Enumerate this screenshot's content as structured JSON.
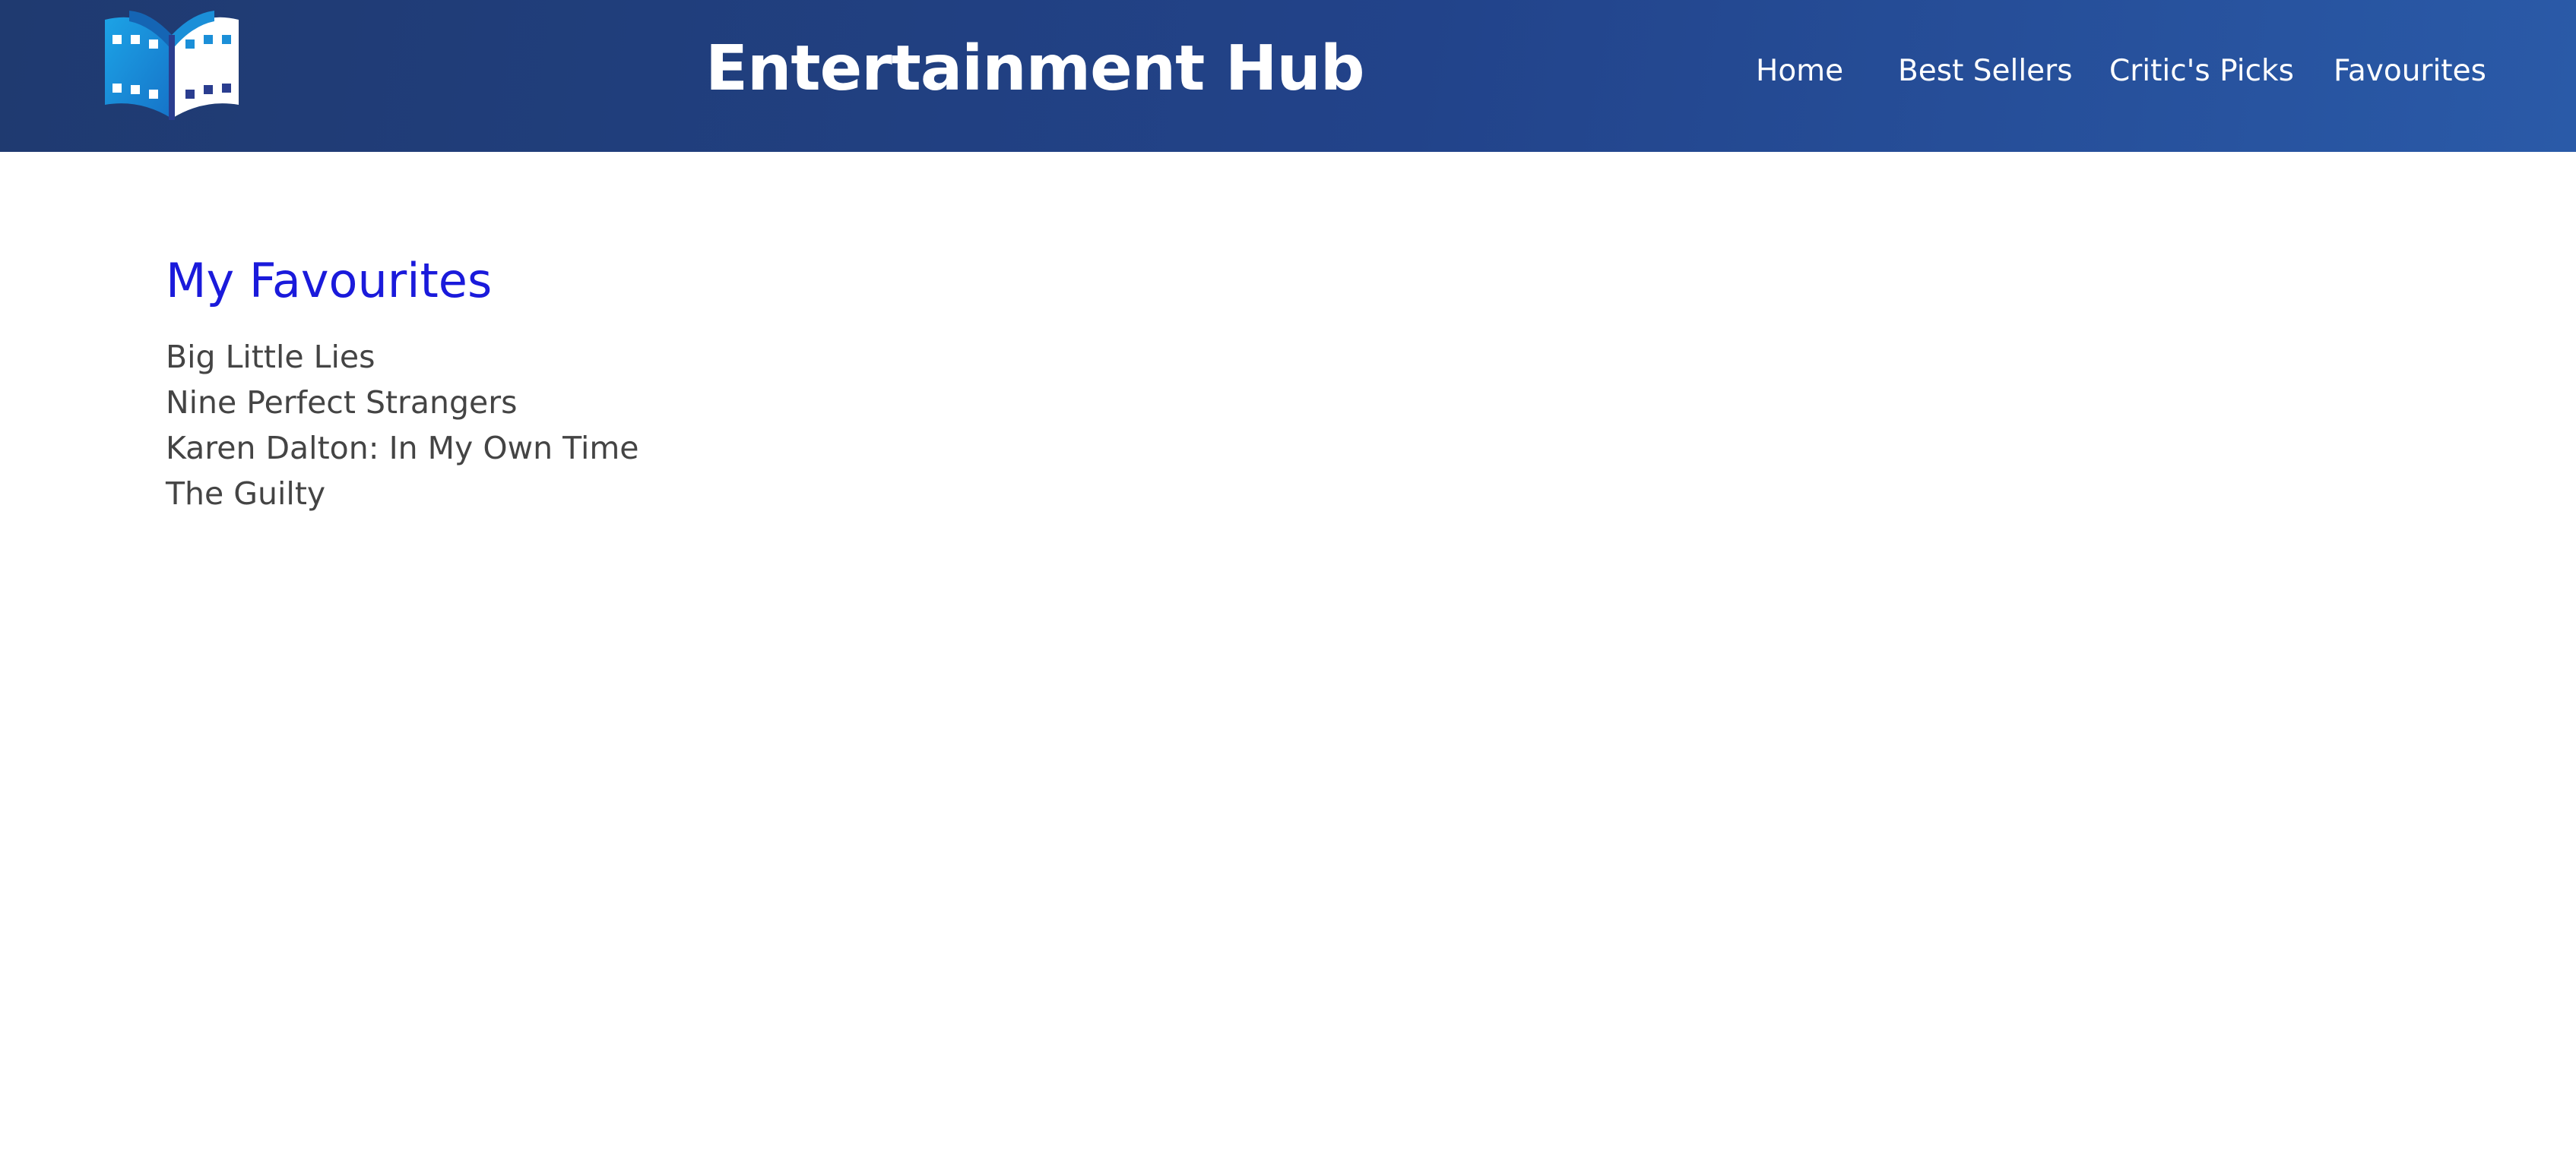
{
  "header": {
    "title": "Entertainment Hub",
    "logo_icon": "book-film-logo-icon",
    "nav": [
      {
        "label": "Home"
      },
      {
        "label": "Best Sellers"
      },
      {
        "label": "Critic's Picks"
      },
      {
        "label": "Favourites"
      }
    ]
  },
  "main": {
    "heading": "My Favourites",
    "favourites": [
      "Big Little Lies",
      "Nine Perfect Strangers",
      "Karen Dalton: In My Own Time",
      "The Guilty"
    ]
  },
  "colors": {
    "header_bg_start": "#1f3a70",
    "header_bg_end": "#2a5aa8",
    "heading_color": "#1a1adb",
    "list_text": "#444444",
    "logo_blue": "#1b8fd8",
    "logo_dark": "#2a3d8f"
  }
}
